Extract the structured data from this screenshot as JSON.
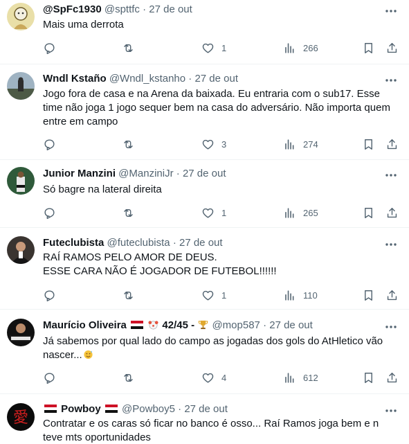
{
  "tweets": [
    {
      "name": "@SpFc1930",
      "handle": "@spttfc",
      "sep": "·",
      "date": "27 de out",
      "lines": [
        "Mais uma derrota"
      ],
      "replies": "",
      "retweets": "",
      "likes": "1",
      "views": "266"
    },
    {
      "name": "Wndl Kstaño",
      "handle": "@Wndl_kstanho",
      "sep": "·",
      "date": "27 de out",
      "lines": [
        "Jogo fora de casa e na Arena da baixada. Eu entraria com o sub17. Esse",
        "time não joga 1 jogo sequer bem na casa do adversário. Não importa quem",
        "entre em campo"
      ],
      "replies": "",
      "retweets": "",
      "likes": "3",
      "views": "274"
    },
    {
      "name": "Junior Manzini",
      "handle": "@ManziniJr",
      "sep": "·",
      "date": "27 de out",
      "lines": [
        "Só bagre na lateral direita"
      ],
      "replies": "",
      "retweets": "",
      "likes": "1",
      "views": "265"
    },
    {
      "name": "Futeclubista",
      "handle": "@futeclubista",
      "sep": "·",
      "date": "27 de out",
      "lines": [
        "RAÍ RAMOS PELO AMOR DE DEUS.",
        "ESSE CARA NÃO É JOGADOR DE FUTEBOL!!!!!!"
      ],
      "replies": "",
      "retweets": "",
      "likes": "1",
      "views": "110"
    },
    {
      "name_a": "Maurício Oliveira",
      "name_b": "42/45 -",
      "handle": "@mop587",
      "sep": "·",
      "date": "27 de out",
      "lines": [
        "Já sabemos por qual lado do campo as jogadas dos gols do AtHletico vão",
        "nascer..."
      ],
      "replies": "",
      "retweets": "",
      "likes": "4",
      "views": "612"
    },
    {
      "name": "Powboy",
      "handle": "@Powboy5",
      "sep": "·",
      "date": "27 de out",
      "lines": [
        "Contratar e os caras só ficar no banco é osso... Raí Ramos joga bem e n",
        "teve mts oportunidades"
      ]
    }
  ],
  "icons": {
    "more": "more-icon",
    "reply": "reply-icon",
    "retweet": "retweet-icon",
    "like": "heart-icon",
    "views": "views-icon",
    "bookmark": "bookmark-icon",
    "share": "share-icon"
  },
  "colors": {
    "text": "#0f1419",
    "secondary": "#536471",
    "divider": "#eff3f4"
  }
}
